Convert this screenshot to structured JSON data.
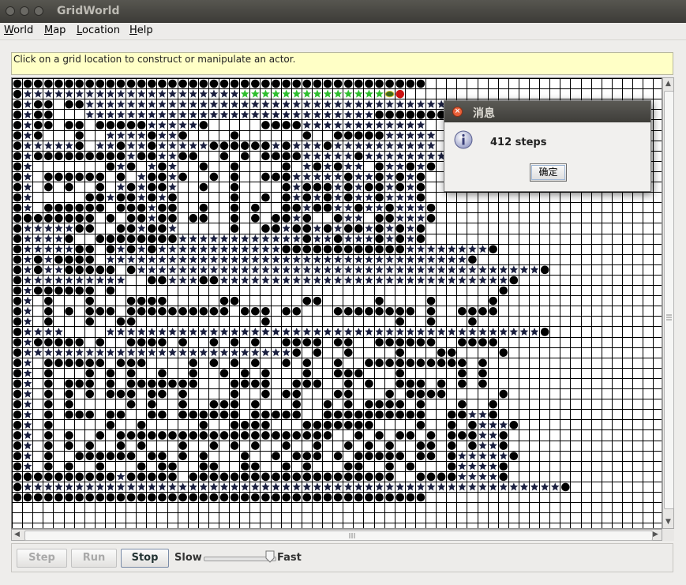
{
  "window": {
    "title": "GridWorld",
    "buttons": [
      "close-icon",
      "minimize-icon",
      "maximize-icon"
    ]
  },
  "menubar": {
    "items": [
      {
        "label": "World",
        "mnemonic": "W",
        "rest": "orld"
      },
      {
        "label": "Map",
        "mnemonic": "M",
        "rest": "ap"
      },
      {
        "label": "Location",
        "mnemonic": "L",
        "rest": "ocation"
      },
      {
        "label": "Help",
        "mnemonic": "H",
        "rest": "elp"
      }
    ]
  },
  "message_bar": {
    "text": "Click on a grid location to construct or manipulate an actor."
  },
  "grid": {
    "columns": 62,
    "visible_rows": 43,
    "legend": {
      "#": "rock (black circle)",
      "*": "flower (dark star)",
      "g": "flower (green star, recent path)",
      "b": "bug (head)",
      "r": "red rock (goal)",
      ".": "empty"
    },
    "rows": [
      "########################################........................",
      "#*********************ggggggggggggggbr........................",
      "#*##.##***********************************........................",
      "#*##...****************************#######........................",
      "#*##.##.#####*****#.....####************........................",
      "#*#...#..****#**#....#......#..#####*****........................",
      "#*****#.**#**#*****######*#***#**********........................",
      "#*#########*##**##..#.#.####*****#********........................",
      "#*.......#*#.*#*..#..#....#.*#*#**.#**#*#........................",
      "#*.######.#.*##*#..#.#..###*****#**#*#*#........................",
      "#*.#.#..#.*#*##*..#..#....#*###*#*##*#*#........................",
      "#*.....##*##*#*#.....#..#.#*#*#*#**#***#........................",
      "#*.######.###*##..#..#.#..##*##**#**#***#........................",
      "########.#.##*##.##..#.#.##*#..#**.##***#........................",
      "#*****##..##*##*.....#..##*##*#*##*#*#*#........................",
      "#****#..########************#**#***#*#*#........................",
      "#*****##.#*#*#************############********#........................",
      "#*#*####.***********************************#........................",
      "#*#**#####.#***************************************#........................",
      "#**********..##***##****************************#........................",
      "#*######.#.....................................#........................",
      "#*.#...#...####.....##......##.....#....#.....#........................",
      "#*.#.#.###.##########.###.##...########.#..####........................",
      "#*.#...#..##............#............#..#...#........................",
      "#****....******************************************#........................",
      "#*#####.#..####.#..#.#.#..####.##..######..####........................",
      "#**************************#.#..#....#...##....#........................",
      "#*.######.###....#.#.#.#..#.#..#..##########.#........................",
      "#*.#...#.#.#..#..#..#.#.#...#..###...#.....#.#........................",
      "#*.#.###.#.#######...####..###..#.#..###.#.#.#........................",
      "#*.#.#.#.###.##.#....#..#.##...##...#.####.....#........................",
      "#*.#.#.....#.#..#..###.#...#..#.#.####.#...#..#........................",
      "#*.#.###.##..##.######.#####..##########..##**#........................",
      "#*.#.....#..#.....#..####...#######....#..#.#***#........................",
      "#*.#.#..#.#####################..#.#.##.#.###**#........................",
      "#*.#.#.#..#.#...#..#.#.#..#..#..#.#.#..##.#.#**#........................",
      "#*.#..######.##.#.#...#..#.###.#.#####.##.#*****#........................",
      "#*.#.#..#...#.##..##..##..#.#...##..#.#...#****#........................",
      "##########*#####.####################..####****#........................",
      "#****************************************************#........................",
      "########################################........................",
      "..............................................................",
      ".............................................................."
    ]
  },
  "dialog": {
    "title": "消息",
    "message": "412 steps",
    "ok_label": "确定",
    "icon": "info-icon"
  },
  "controls": {
    "step_label": "Step",
    "run_label": "Run",
    "stop_label": "Stop",
    "slow_label": "Slow",
    "fast_label": "Fast",
    "speed_level": 0.95
  },
  "colors": {
    "rock": "#000000",
    "flower_dark": "#1a1f3f",
    "flower_path": "#2fbf2f",
    "goal_rock": "#cc1111",
    "grid_line": "#000000",
    "message_bg": "#ffffc6"
  }
}
